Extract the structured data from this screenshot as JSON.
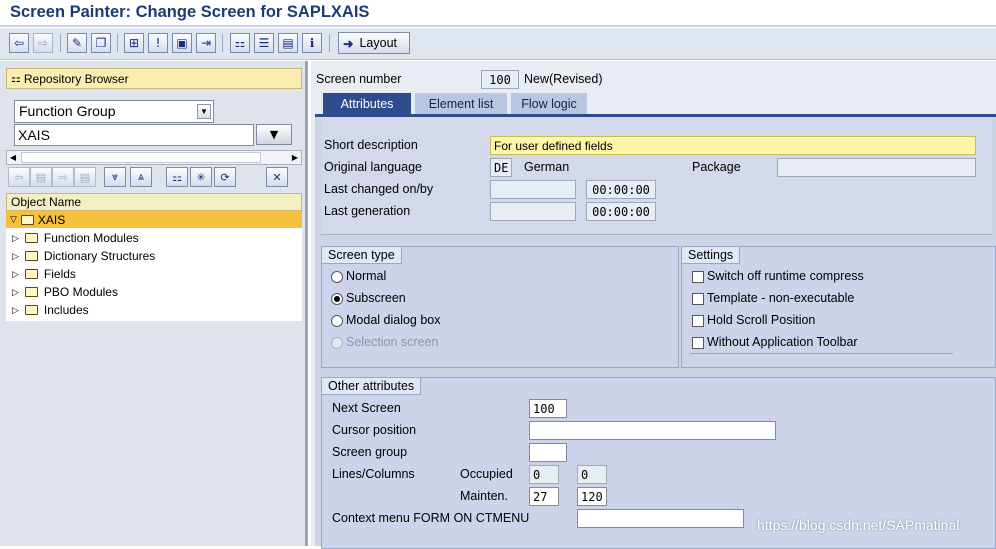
{
  "title": "Screen Painter: Change Screen for SAPLXAIS",
  "toolbar": {
    "layout_label": "Layout"
  },
  "left": {
    "repo_title": "Repository Browser",
    "object_type": "Function Group",
    "object_name": "XAIS",
    "column_header": "Object Name",
    "tree_root": "XAIS",
    "tree_items": [
      "Function Modules",
      "Dictionary Structures",
      "Fields",
      "PBO Modules",
      "Includes"
    ]
  },
  "screen": {
    "number_label": "Screen number",
    "number_value": "100",
    "status": "New(Revised)"
  },
  "tabs": [
    "Attributes",
    "Element list",
    "Flow logic"
  ],
  "attributes": {
    "short_desc_label": "Short description",
    "short_desc_value": "For user defined fields",
    "orig_lang_label": "Original language",
    "orig_lang_value": "DE",
    "orig_lang_name": "German",
    "package_label": "Package",
    "package_value": "",
    "last_changed_label": "Last changed on/by",
    "last_changed_time": "00:00:00",
    "last_gen_label": "Last generation",
    "last_gen_time": "00:00:00"
  },
  "screen_type": {
    "title": "Screen type",
    "options": [
      "Normal",
      "Subscreen",
      "Modal dialog box",
      "Selection screen"
    ],
    "selected": "Subscreen"
  },
  "settings": {
    "title": "Settings",
    "options": [
      "Switch off runtime compress",
      "Template - non-executable",
      "Hold Scroll Position",
      "Without Application Toolbar"
    ]
  },
  "other": {
    "title": "Other attributes",
    "next_screen_label": "Next Screen",
    "next_screen_value": "100",
    "cursor_label": "Cursor position",
    "cursor_value": "",
    "group_label": "Screen group",
    "group_value": "",
    "lines_cols_label": "Lines/Columns",
    "occupied_label": "Occupied",
    "occupied_lines": "0",
    "occupied_cols": "0",
    "mainten_label": "Mainten.",
    "mainten_lines": "27",
    "mainten_cols": "120",
    "context_label": "Context menu FORM ON CTMENU",
    "context_value": ""
  },
  "watermark": "https://blog.csdn.net/SAPmatinal"
}
